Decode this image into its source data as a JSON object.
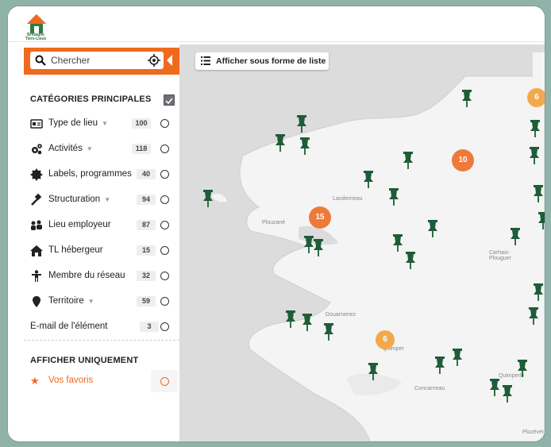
{
  "header": {
    "logo_text_line1": "Bretagne",
    "logo_text_line2": "Tiers-Lieux"
  },
  "search": {
    "placeholder": "Chercher"
  },
  "sidebar": {
    "main_title": "CATÉGORIES PRINCIPALES",
    "items": [
      {
        "label": "Type de lieu",
        "dropdown": true,
        "count": "100",
        "icon": "id-card-icon"
      },
      {
        "label": "Activités",
        "dropdown": true,
        "count": "118",
        "icon": "gears-icon"
      },
      {
        "label": "Labels, programmes",
        "dropdown": false,
        "count": "40",
        "icon": "certificate-icon"
      },
      {
        "label": "Structuration",
        "dropdown": true,
        "count": "94",
        "icon": "hammer-icon"
      },
      {
        "label": "Lieu employeur",
        "dropdown": false,
        "count": "87",
        "icon": "people-icon"
      },
      {
        "label": "TL hébergeur",
        "dropdown": false,
        "count": "15",
        "icon": "home-icon"
      },
      {
        "label": "Membre du réseau",
        "dropdown": false,
        "count": "32",
        "icon": "person-icon"
      },
      {
        "label": "Territoire",
        "dropdown": true,
        "count": "59",
        "icon": "map-marker-icon"
      },
      {
        "label": "E-mail de l'élément",
        "dropdown": false,
        "count": "3",
        "icon": ""
      }
    ],
    "only_title": "AFFICHER UNIQUEMENT",
    "favorites_label": "Vos favoris"
  },
  "map": {
    "list_button": "Afficher sous forme de liste",
    "clusters": [
      "6",
      "10",
      "15",
      "6"
    ],
    "places": [
      "Landerneau",
      "Plouzané",
      "Carhaix-Plouguer",
      "Douarnenez",
      "Quimper",
      "Concarneau",
      "Quimperlé",
      "Plozévet"
    ]
  },
  "colors": {
    "accent": "#ef6a1d",
    "pin": "#1f5c38",
    "cluster_orange": "#ee7a3a",
    "cluster_light": "#f2a94e"
  }
}
